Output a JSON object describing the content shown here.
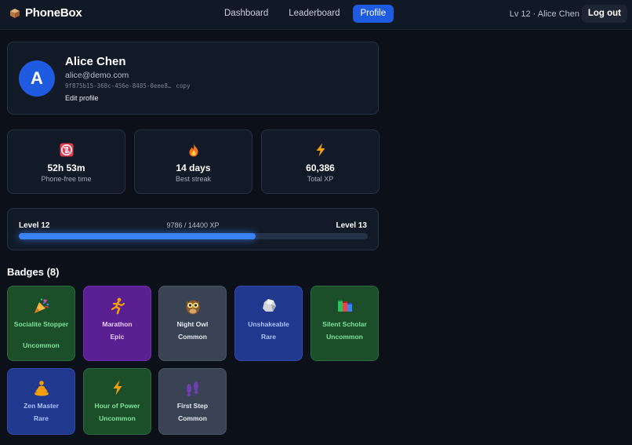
{
  "header": {
    "brand": "PhoneBox",
    "nav": [
      {
        "label": "Dashboard"
      },
      {
        "label": "Leaderboard"
      },
      {
        "label": "Profile"
      }
    ],
    "user_line": "Lv 12 · Alice Chen",
    "logout_label": "Log out"
  },
  "profile": {
    "avatar_letter": "A",
    "name": "Alice Chen",
    "email": "alice@demo.com",
    "uid": "9f875b15-368c-456e-8485-0eee8…",
    "copy_label": "copy",
    "edit_label": "Edit profile"
  },
  "stats": [
    {
      "icon": "no-phone-icon",
      "value": "52h 53m",
      "label": "Phone-free time"
    },
    {
      "icon": "fire-icon",
      "value": "14 days",
      "label": "Best streak"
    },
    {
      "icon": "lightning-icon",
      "value": "60,386",
      "label": "Total XP"
    }
  ],
  "level": {
    "current": "Level 12",
    "next": "Level 13",
    "progress_text": "9786 / 14400 XP",
    "progress": 0.6796
  },
  "badges_title": "Badges (8)",
  "badges": [
    {
      "icon": "party-popper-icon",
      "name": "Socialite Stopper",
      "rarity": "Uncommon"
    },
    {
      "icon": "runner-icon",
      "name": "Marathon",
      "rarity": "Epic"
    },
    {
      "icon": "owl-icon",
      "name": "Night Owl",
      "rarity": "Common"
    },
    {
      "icon": "rock-icon",
      "name": "Unshakeable",
      "rarity": "Rare"
    },
    {
      "icon": "books-icon",
      "name": "Silent Scholar",
      "rarity": "Uncommon"
    },
    {
      "icon": "meditation-icon",
      "name": "Zen Master",
      "rarity": "Rare"
    },
    {
      "icon": "lightning-icon",
      "name": "Hour of Power",
      "rarity": "Uncommon"
    },
    {
      "icon": "footprints-icon",
      "name": "First Step",
      "rarity": "Common"
    }
  ],
  "colors": {
    "accent": "#1f5be0",
    "uncommon_bg": "#1c4e2a",
    "epic_bg": "#5b1f94",
    "common_bg": "#3a4353",
    "rare_bg": "#21388f"
  }
}
